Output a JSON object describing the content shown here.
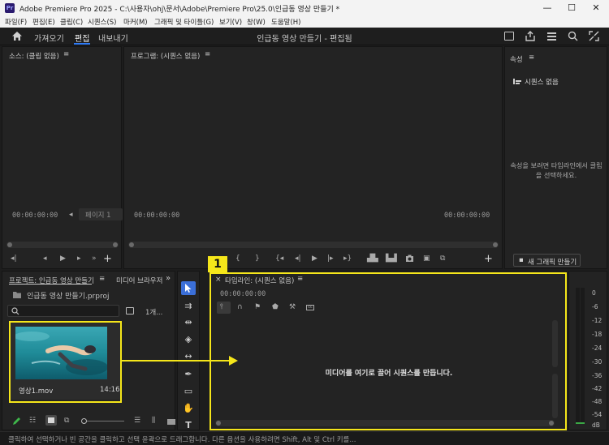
{
  "window": {
    "app_icon": "Pr",
    "title": "Adobe Premiere Pro 2025 - C:\\사용자\\ohj\\문서\\Adobe\\Premiere Pro\\25.0\\인급동 영상 만들기 *",
    "minimize": "—",
    "maximize": "☐",
    "close": "✕"
  },
  "menu": [
    "파일(F)",
    "편집(E)",
    "클립(C)",
    "시퀀스(S)",
    "마커(M)",
    "그래픽 및 타이틀(G)",
    "보기(V)",
    "창(W)",
    "도움말(H)"
  ],
  "header": {
    "home_icon": "home-icon",
    "tabs": [
      "가져오기",
      "편집",
      "내보내기"
    ],
    "active_tab": "편집",
    "doc_title": "인급동 영상 만들기 - 편집됨"
  },
  "source_panel": {
    "title": "소스: (클립 없음)",
    "menu_glyph": "≡",
    "timecode_left": "00:00:00:00",
    "page_label": "페이지 1"
  },
  "program_panel": {
    "title": "프로그램: (시퀀스 없음)",
    "menu_glyph": "≡",
    "timecode_left": "00:00:00:00",
    "timecode_right": "00:00:00:00"
  },
  "properties_panel": {
    "title": "속성",
    "section": "시퀀스 없음",
    "message": "속성을 보려면 타임라인에서 클립을 선택하세요.",
    "new_graphic_button": "새 그래픽 만들기"
  },
  "project_panel": {
    "tab_project": "프로젝트: 인급동 영상 만들기",
    "tab_media_browser": "미디어 브라우저",
    "menu_glyph": "≡",
    "overflow": "»",
    "file_name": "인급동 영상 만들기.prproj",
    "item_count": "1개...",
    "clip": {
      "name": "영상1.mov",
      "duration": "14:16"
    }
  },
  "timeline_panel": {
    "title": "타임라인: (시퀀스 없음)",
    "menu_glyph": "≡",
    "timecode": "00:00:00:00",
    "drop_message": "미디어를 여기로 끌어 시퀀스를 만듭니다."
  },
  "annotation": {
    "badge": "1",
    "color": "#f5e61a"
  },
  "audio_meter": {
    "labels": [
      "0",
      "-6",
      "-12",
      "-18",
      "-24",
      "-30",
      "-36",
      "-42",
      "-48",
      "-54",
      "dB"
    ]
  },
  "status": "클릭하여 선택하거나 빈 공간을 클릭하고 선택 윤곽으로 드래그합니다. 다른 옵션을 사용하려면 Shift, Alt 및 Ctrl 키를...",
  "colors": {
    "accent_blue": "#2f7bf6",
    "annotation_yellow": "#f5e61a",
    "panel_bg": "#232323"
  }
}
